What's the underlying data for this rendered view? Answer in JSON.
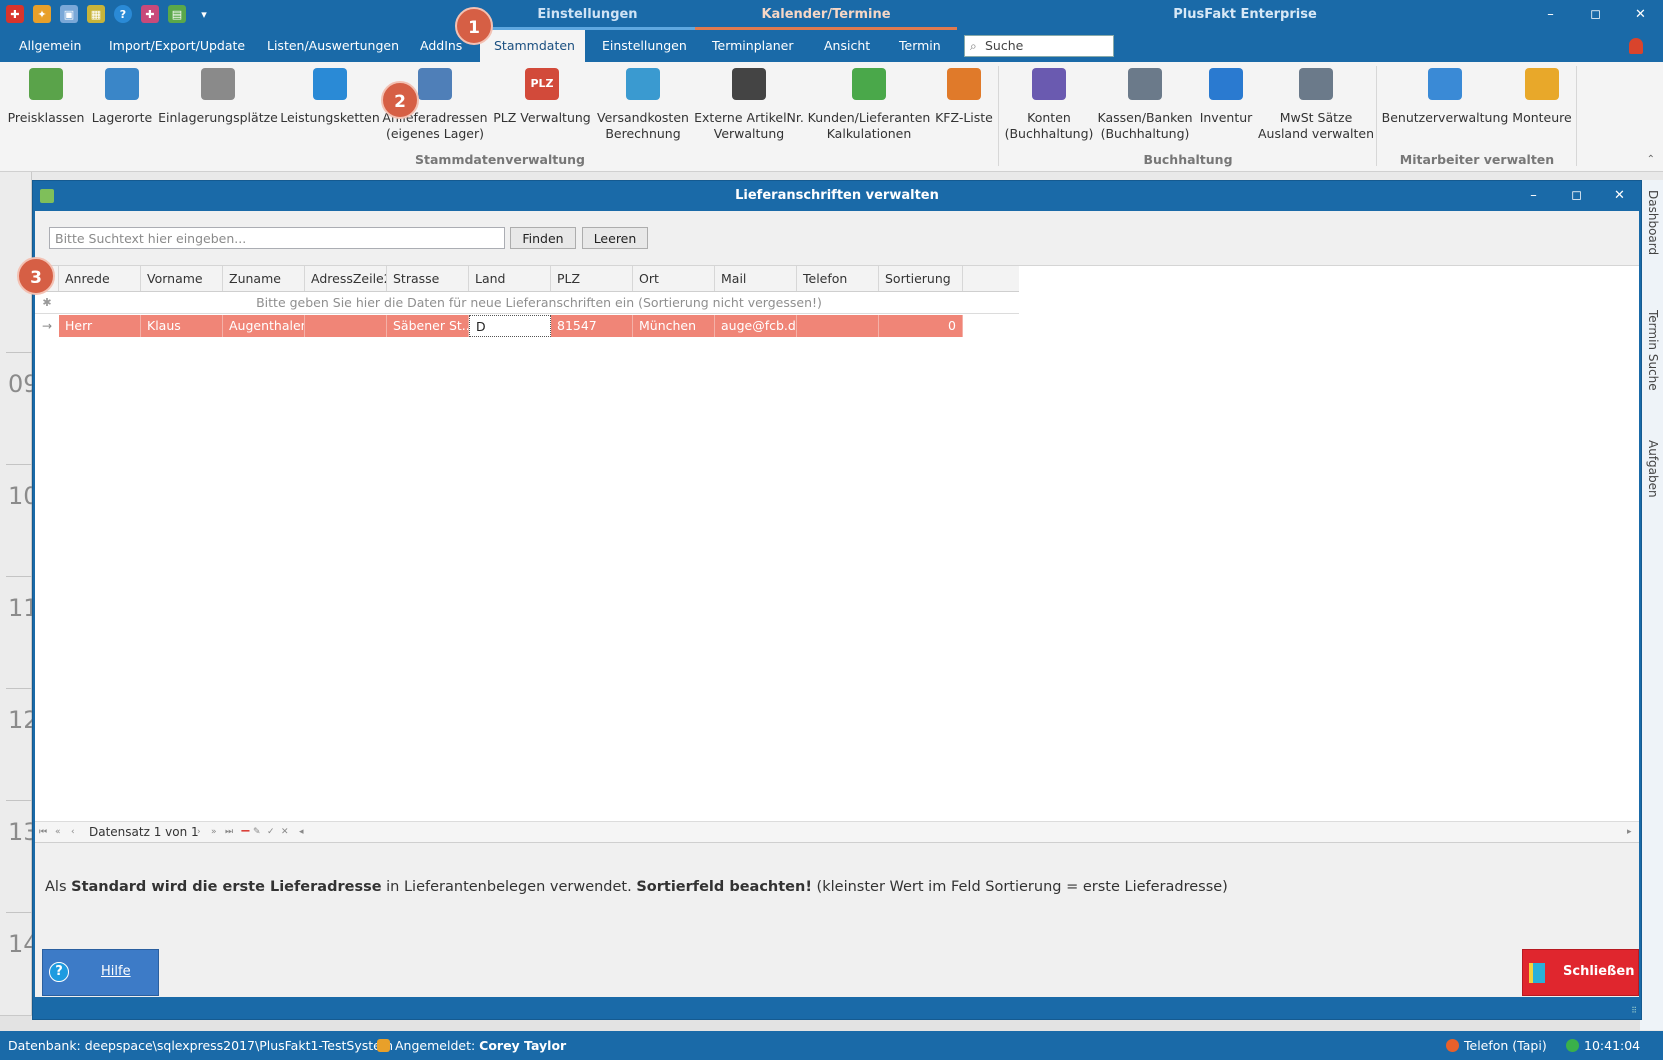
{
  "titlebar": {
    "context_tabs": [
      "Einstellungen",
      "Kalender/Termine"
    ],
    "app_title": "PlusFakt Enterprise",
    "window_buttons": [
      "–",
      "◻",
      "✕"
    ],
    "qat_dropdown": "▾"
  },
  "menu": {
    "items": [
      "Allgemein",
      "Import/Export/Update",
      "Listen/Auswertungen",
      "AddIns",
      "Stammdaten",
      "Einstellungen",
      "Terminplaner",
      "Ansicht",
      "Termin"
    ],
    "active": "Stammdaten",
    "search_placeholder": "Suche",
    "search_glyph": "⌕"
  },
  "ribbon": {
    "buttons": [
      {
        "label": "Preisklassen",
        "icon": "money-icon",
        "color": "#5aa34a"
      },
      {
        "label": "Lagerorte",
        "icon": "warehouse-icon",
        "color": "#3a86c8"
      },
      {
        "label": "Einlagerungsplätze",
        "icon": "storage-cart-icon",
        "color": "#8a8a8a"
      },
      {
        "label": "Leistungsketten",
        "icon": "chain-link-icon",
        "color": "#2a8ad6"
      },
      {
        "label": "Anlieferadressen\n(eigenes Lager)",
        "icon": "delivery-truck-icon",
        "color": "#4f7fb8"
      },
      {
        "label": "PLZ Verwaltung",
        "icon": "plz-icon",
        "color": "#d24a3a",
        "glyph": "PLZ"
      },
      {
        "label": "Versandkosten\nBerechnung",
        "icon": "shipping-cost-icon",
        "color": "#3a9ad0"
      },
      {
        "label": "Externe ArtikelNr.\nVerwaltung",
        "icon": "barcode-icon",
        "color": "#444444"
      },
      {
        "label": "Kunden/Lieferanten\nKalkulationen",
        "icon": "calculation-envelope-icon",
        "color": "#4aa84a"
      },
      {
        "label": "KFZ-Liste",
        "icon": "car-icon",
        "color": "#e07a2a"
      },
      {
        "label": "Konten\n(Buchhaltung)",
        "icon": "bank-icon",
        "color": "#6a5ab0"
      },
      {
        "label": "Kassen/Banken\n(Buchhaltung)",
        "icon": "cash-register-icon",
        "color": "#6b7a8a"
      },
      {
        "label": "Inventur",
        "icon": "forklift-icon",
        "color": "#2a7ad0"
      },
      {
        "label": "MwSt Sätze\nAusland verwalten",
        "icon": "tax-register-icon",
        "color": "#6b7a8a"
      },
      {
        "label": "Benutzerverwaltung",
        "icon": "user-admin-icon",
        "color": "#3a8ad6"
      },
      {
        "label": "Monteure",
        "icon": "worker-icon",
        "color": "#e8a82a"
      }
    ],
    "groups": [
      "Stammdatenverwaltung",
      "Buchhaltung",
      "Mitarbeiter verwalten"
    ],
    "collapse_glyph": "⌃"
  },
  "background": {
    "hours": [
      "09",
      "10",
      "11",
      "12",
      "13",
      "14"
    ],
    "side_tabs": [
      "Dashboard",
      "Termin Suche",
      "Aufgaben"
    ]
  },
  "modal": {
    "title": "Lieferanschriften verwalten",
    "window_buttons": [
      "–",
      "◻",
      "✕"
    ],
    "search": {
      "placeholder": "Bitte Suchtext hier eingeben...",
      "find_label": "Finden",
      "clear_label": "Leeren"
    },
    "grid": {
      "columns": [
        "Anrede",
        "Vorname",
        "Zuname",
        "AdressZeile2",
        "Strasse",
        "Land",
        "PLZ",
        "Ort",
        "Mail",
        "Telefon",
        "Sortierung"
      ],
      "new_row_indicator": "✱",
      "new_row_hint": "Bitte geben Sie hier die Daten für neue Lieferanschriften ein (Sortierung nicht vergessen!)",
      "row_indicator": "→",
      "rows": [
        [
          "Herr",
          "Klaus",
          "Augenthaler",
          "",
          "Säbener St...",
          "D",
          "81547",
          "München",
          "auge@fcb.de",
          "",
          "0"
        ]
      ],
      "selected_row_color": "#f08577"
    },
    "navigator": {
      "first": "⏮",
      "prev_page": "«",
      "prev": "‹",
      "record_text": "Datensatz 1 von 1",
      "next": "›",
      "next_page": "»",
      "last": "⏭",
      "delete": "−",
      "edit": "✎",
      "confirm": "✓",
      "cancel": "✕",
      "scroll_left": "◂",
      "scroll_right": "▸"
    },
    "info": {
      "p1": "Als ",
      "b1": "Standard wird die erste Lieferadresse",
      "p2": " in Lieferantenbelegen verwendet. ",
      "b2": "Sortierfeld beachten!",
      "p3": "  (kleinster Wert im Feld Sortierung = erste Lieferadresse)"
    },
    "help_glyph": "?",
    "help_label": "Hilfe",
    "close_label": "Schließen",
    "grip_glyph": "⠿"
  },
  "statusbar": {
    "database": "Datenbank: deepspace\\sqlexpress2017\\PlusFakt1-TestSystem",
    "logged_in_label": "Angemeldet: ",
    "user": "Corey Taylor",
    "telephony": "Telefon (Tapi)",
    "time": "10:41:04"
  },
  "annotations": [
    "1",
    "2",
    "3"
  ],
  "colors": {
    "accent": "#1a6aa8",
    "selected_row": "#f08577",
    "badge": "#d65f45",
    "help": "#3d7bc7",
    "close": "#e0262e"
  }
}
